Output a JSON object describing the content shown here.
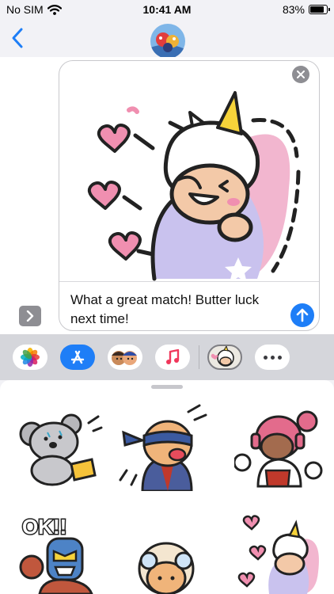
{
  "status_bar": {
    "carrier": "No SIM",
    "time": "10:41 AM",
    "battery_percent_label": "83%",
    "battery_level": 0.83
  },
  "nav": {
    "back_icon": "chevron-left-icon",
    "avatar_icon": "contact-avatar"
  },
  "compose": {
    "message_text": "What a great match! Butter luck next time!",
    "send_icon": "arrow-up-icon",
    "remove_icon": "close-icon",
    "expand_icon": "chevron-right-icon",
    "attached_sticker": "unicorn-hood-sticker"
  },
  "app_strip": {
    "apps": [
      "photos-app-icon",
      "app-store-icon",
      "memoji-icon",
      "music-icon",
      "brawl-stickers-icon",
      "more-icon"
    ],
    "selected": "brawl-stickers-icon"
  },
  "drawer": {
    "stickers": [
      "koala-sticker",
      "masked-bandit-sticker",
      "headphones-girl-sticker",
      "ok-wrestler-sticker",
      "goggles-kid-sticker",
      "unicorn-hearts-sticker"
    ]
  },
  "colors": {
    "accent_blue": "#1e7ef7",
    "strip_bg": "#d5d6db",
    "sticker_pink": "#f2b6cf",
    "sticker_lavender": "#c9c2ee"
  }
}
